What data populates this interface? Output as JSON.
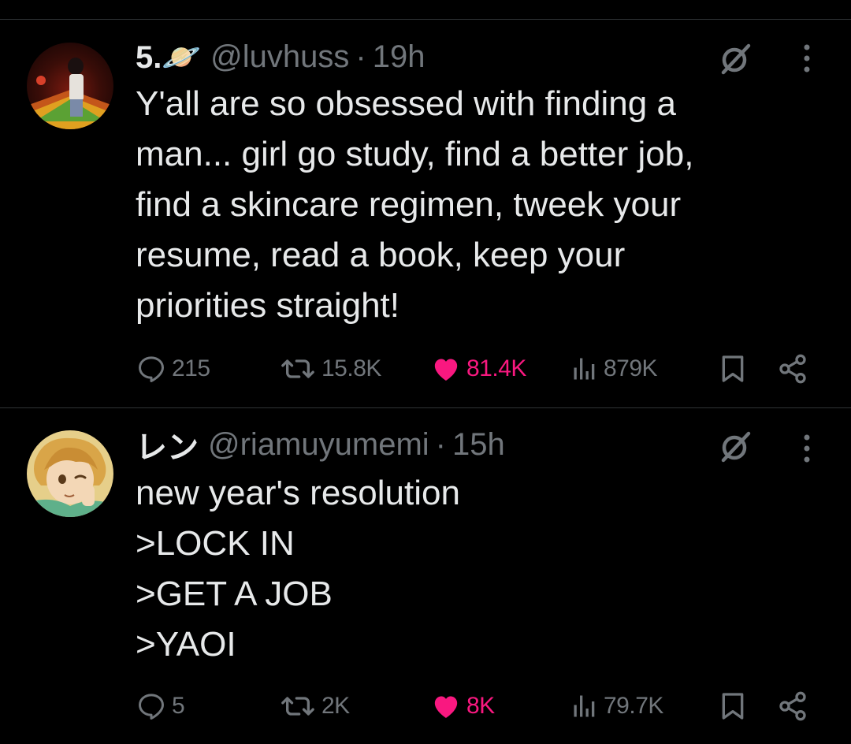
{
  "tweets": [
    {
      "display_name": "5.🪐",
      "handle": "@luvhuss",
      "separator": "·",
      "time": "19h",
      "lines": [
        "Y'all are so obsessed with finding a",
        "man... girl go study, find a better job,",
        "find a skincare regimen, tweek your",
        "resume, read a book, keep your",
        "priorities straight!"
      ],
      "replies": "215",
      "reposts": "15.8K",
      "likes": "81.4K",
      "views": "879K"
    },
    {
      "display_name": "レン",
      "handle": "@riamuyumemi",
      "separator": "·",
      "time": "15h",
      "lines": [
        "new year's resolution",
        ">LOCK IN",
        ">GET A JOB",
        ">YAOI"
      ],
      "replies": "5",
      "reposts": "2K",
      "likes": "8K",
      "views": "79.7K"
    }
  ],
  "colors": {
    "background": "#000000",
    "text": "#e7e9ea",
    "muted": "#71767b",
    "like_active": "#f91880",
    "divider": "#2f3336"
  },
  "icons": [
    "reply-icon",
    "repost-icon",
    "heart-icon",
    "views-icon",
    "bookmark-icon",
    "share-icon",
    "grok-icon",
    "more-icon"
  ]
}
